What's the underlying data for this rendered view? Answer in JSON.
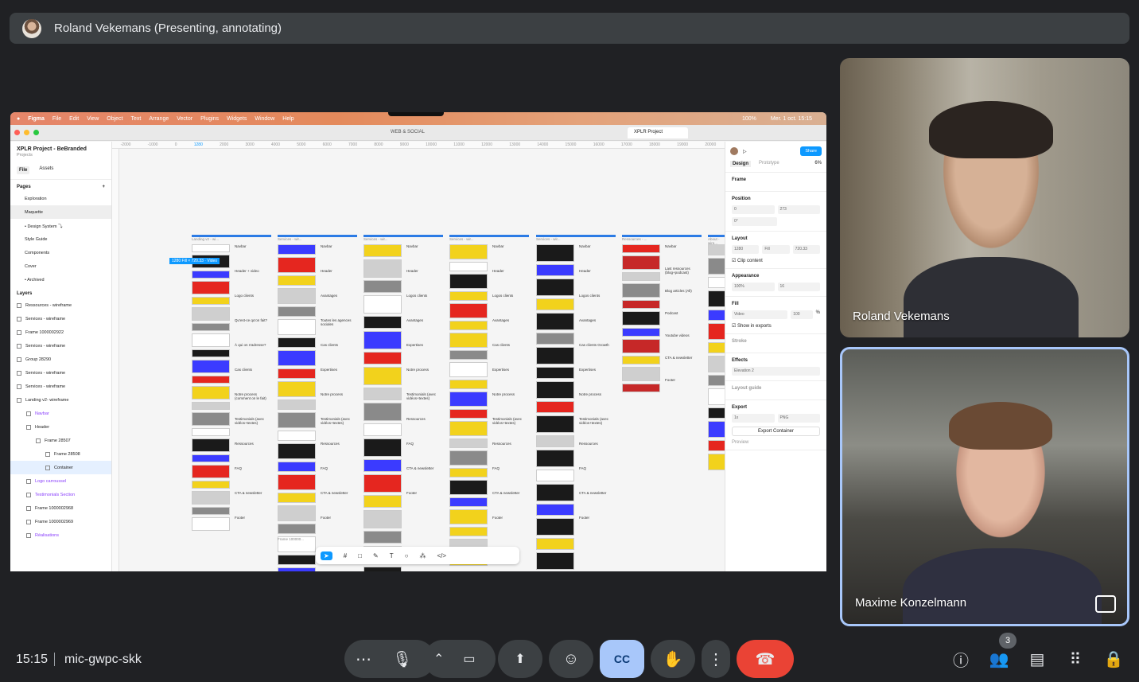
{
  "topbar": {
    "presenter_label": "Roland Vekemans (Presenting, annotating)"
  },
  "figma": {
    "menu": [
      "Figma",
      "File",
      "Edit",
      "View",
      "Object",
      "Text",
      "Arrange",
      "Vector",
      "Plugins",
      "Widgets",
      "Window",
      "Help"
    ],
    "status": {
      "battery": "100%",
      "datetime": "Mer. 1 oct. 15:15"
    },
    "tabs": {
      "inactive": "WEB & SOCIAL",
      "active": "XPLR Project"
    },
    "project": {
      "name": "XPLR Project - BeBranded",
      "location": "Projects"
    },
    "file_tabs": {
      "file": "File",
      "assets": "Assets"
    },
    "pages_title": "Pages",
    "pages": [
      "Exploration",
      "Maquette",
      "• Design System ⤵",
      "Style Guide",
      "Components",
      "Cover",
      "• Archived"
    ],
    "layers_title": "Layers",
    "layers": [
      "Ressources - wireframe",
      "Services - wireframe",
      "Frame 1000002922",
      "Services - wireframe",
      "Group 28290",
      "Services - wireframe",
      "Services - wireframe",
      "Landing v2- wireframe",
      "Navbar",
      "Header",
      "Frame 28507",
      "Frame 28508",
      "Container",
      "Logo carroussel",
      "Testimonials Section",
      "Frame 1000002968",
      "Frame 1000002969",
      "Réalisations"
    ],
    "ruler": [
      "-2000",
      "-1000",
      "0",
      "1280",
      "2000",
      "3000",
      "4000",
      "5000",
      "6000",
      "7000",
      "8000",
      "9000",
      "10000",
      "11000",
      "12000",
      "13000",
      "14000",
      "15000",
      "16000",
      "17000",
      "18000",
      "19000",
      "20000"
    ],
    "selection_badge": "1280 Fill × 720.33 · Video",
    "columns": [
      {
        "title": "Landing v2 - wi...",
        "labels": [
          "Navbar",
          "Header + video",
          "Logo clients",
          "Qu'est-ce qu'on fait?",
          "À qui on s'adresse?",
          "Cas clients",
          "Notre process (comment on le fait)",
          "Testimonials (avec vidéos+textes)",
          "Ressources",
          "FAQ",
          "CTA & newsletter",
          "Footer"
        ]
      },
      {
        "title": "Services - wir...",
        "labels": [
          "Navbar",
          "Header",
          "Avantages",
          "Toutes les agences sociales",
          "Cas clients",
          "Expertises",
          "Notre process",
          "Testimonials (avec vidéos+textes)",
          "Ressources",
          "FAQ",
          "CTA & newsletter",
          "Footer"
        ]
      },
      {
        "title": "Services - wir...",
        "labels": [
          "Navbar",
          "Header",
          "Logos clients",
          "Avantages",
          "Expertises",
          "Notre process",
          "Testimonials (avec vidéos+textes)",
          "Ressources",
          "FAQ",
          "CTA & newsletter",
          "Footer"
        ]
      },
      {
        "title": "Services - wir...",
        "labels": [
          "Navbar",
          "Header",
          "Logos clients",
          "Avantages",
          "Cas clients",
          "Expertises",
          "Notre process",
          "Testimonials (avec vidéos+textes)",
          "Ressources",
          "FAQ",
          "CTA & newsletter",
          "Footer"
        ]
      },
      {
        "title": "Services - wir...",
        "labels": [
          "Navbar",
          "Header",
          "Logos clients",
          "Avantages",
          "Cas clients Growth",
          "Expertises",
          "Notre process",
          "Testimonials (avec vidéos+textes)",
          "Ressources",
          "FAQ",
          "CTA & newsletter",
          "Footer"
        ]
      },
      {
        "title": "Ressources - ...",
        "labels": [
          "Navbar",
          "Last ressources (blog+podcast)",
          "Blog articles (All)",
          "Podcast",
          "Youtube videos",
          "CTA & newsletter",
          "Footer"
        ]
      },
      {
        "title": "About - wire...",
        "labels": []
      }
    ],
    "frame_label": "Frame 100000...",
    "right_panel": {
      "tabs": {
        "design": "Design",
        "prototype": "Prototype",
        "zoom": "6%"
      },
      "share": "Share",
      "frame": "Frame",
      "position": "Position",
      "x": "0",
      "y": "273",
      "rotation": "0°",
      "layout": "Layout",
      "w": "1280",
      "w_mode": "Fill",
      "h": "720.33",
      "clip_content": "Clip content",
      "appearance": "Appearance",
      "opacity": "100%",
      "radius": "16",
      "fill": "Fill",
      "fill_name": "Video",
      "fill_opacity": "100",
      "fill_unit": "%",
      "show_in_exports": "Show in exports",
      "stroke": "Stroke",
      "effects": "Effects",
      "effect_name": "Elevation 2",
      "layout_guide": "Layout guide",
      "export": "Export",
      "export_scale": "1x",
      "export_format": "PNG",
      "export_button": "Export Container",
      "preview": "Preview"
    }
  },
  "participants": [
    {
      "name": "Roland Vekemans"
    },
    {
      "name": "Maxime Konzelmann"
    }
  ],
  "bottom_bar": {
    "time": "15:15",
    "meeting_code": "mic-gwpc-skk",
    "people_count": "3",
    "colors": {
      "end_call": "#ea4335",
      "captions_active": "#a8c7fa"
    }
  }
}
